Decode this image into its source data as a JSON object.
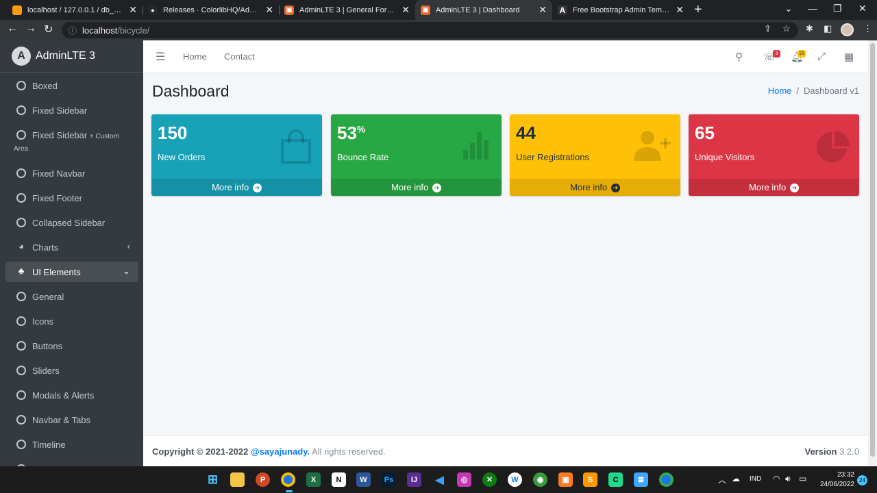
{
  "browser": {
    "tabs": [
      {
        "title": "localhost / 127.0.0.1 / db_bicycle",
        "favicon_color": "#f89c0e",
        "active": false
      },
      {
        "title": "Releases · ColorlibHQ/AdminLTE",
        "favicon_color": "#24292e",
        "active": false
      },
      {
        "title": "AdminLTE 3 | General Form Eleme",
        "favicon_color": "#e8672c",
        "active": false
      },
      {
        "title": "AdminLTE 3 | Dashboard",
        "favicon_color": "#e8672c",
        "active": true
      },
      {
        "title": "Free Bootstrap Admin Template",
        "favicon_color": "#35363a",
        "active": false
      }
    ],
    "url_host": "localhost",
    "url_path": "/bicycle/"
  },
  "sidebar": {
    "brand": "AdminLTE 3",
    "brand_logo_letter": "A",
    "items": [
      {
        "label": "Boxed"
      },
      {
        "label": "Fixed Sidebar"
      },
      {
        "label": "Fixed Sidebar",
        "small": "+ Custom",
        "wrap": "Area"
      },
      {
        "label": "Fixed Navbar"
      },
      {
        "label": "Fixed Footer"
      },
      {
        "label": "Collapsed Sidebar"
      },
      {
        "label": "Charts"
      },
      {
        "label": "UI Elements"
      },
      {
        "label": "General"
      },
      {
        "label": "Icons"
      },
      {
        "label": "Buttons"
      },
      {
        "label": "Sliders"
      },
      {
        "label": "Modals & Alerts"
      },
      {
        "label": "Navbar & Tabs"
      },
      {
        "label": "Timeline"
      }
    ]
  },
  "topnav": {
    "links": [
      "Home",
      "Contact"
    ],
    "messages_badge": "3",
    "notifications_badge": "15"
  },
  "page": {
    "title": "Dashboard",
    "breadcrumb_home": "Home",
    "breadcrumb_current": "Dashboard v1",
    "breadcrumb_sep": "/"
  },
  "cards": [
    {
      "value": "150",
      "suffix": "",
      "label": "New Orders",
      "more": "More info",
      "color": "#17a2b8",
      "icon": "shopping-bag-icon"
    },
    {
      "value": "53",
      "suffix": "%",
      "label": "Bounce Rate",
      "more": "More info",
      "color": "#28a745",
      "icon": "bar-chart-icon"
    },
    {
      "value": "44",
      "suffix": "",
      "label": "User Registrations",
      "more": "More info",
      "color": "#ffc107",
      "icon": "user-plus-icon"
    },
    {
      "value": "65",
      "suffix": "",
      "label": "Unique Visitors",
      "more": "More info",
      "color": "#dc3545",
      "icon": "pie-chart-icon"
    }
  ],
  "footer": {
    "copyright": "Copyright © 2021-2022",
    "author": "@sayajunady.",
    "rights": "All rights reserved.",
    "version_label": "Version",
    "version": "3.2.0"
  },
  "taskbar": {
    "lang": "IND",
    "time": "23:32",
    "date": "24/06/2022",
    "notifications": "24"
  }
}
